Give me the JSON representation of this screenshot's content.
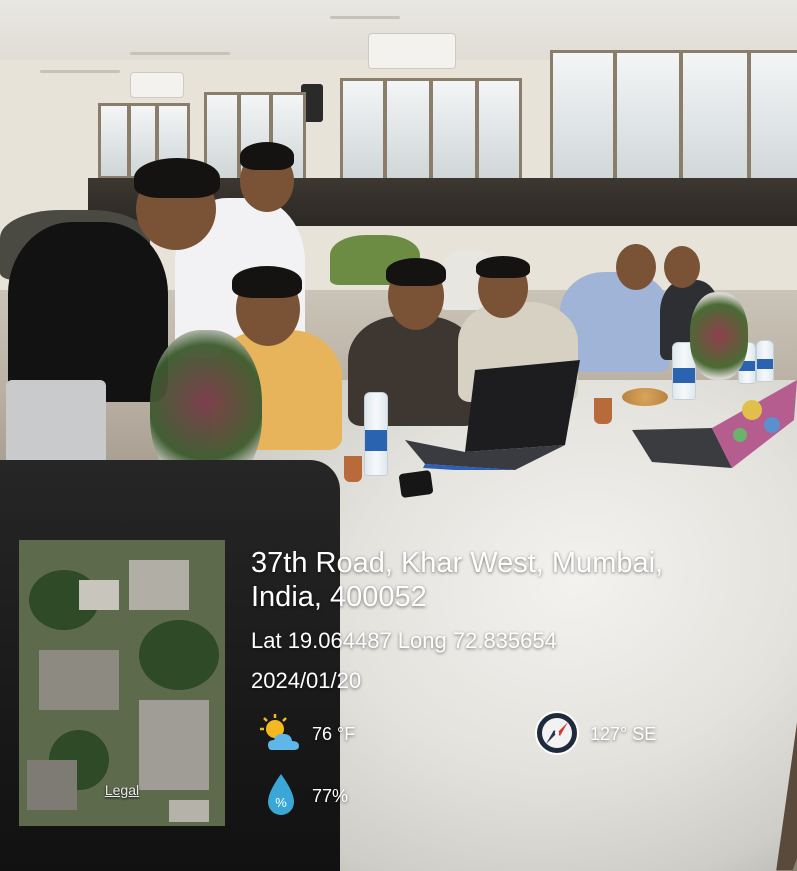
{
  "geotag": {
    "address_line1": "37th Road, Khar West, Mumbai,",
    "address_line2": "India, 400052",
    "coordinates": "Lat 19.064487 Long 72.835654",
    "date": "2024/01/20",
    "temperature": "76 °F",
    "wind": "127° SE",
    "humidity": "77%",
    "map_legal": "Legal"
  },
  "icons": {
    "weather": "partly-sunny-icon",
    "compass": "compass-icon",
    "humidity": "humidity-drop-icon"
  },
  "colors": {
    "overlay_text": "#ffffff",
    "compass_needle": "#d23b2e",
    "drop": "#3aa7d6"
  }
}
